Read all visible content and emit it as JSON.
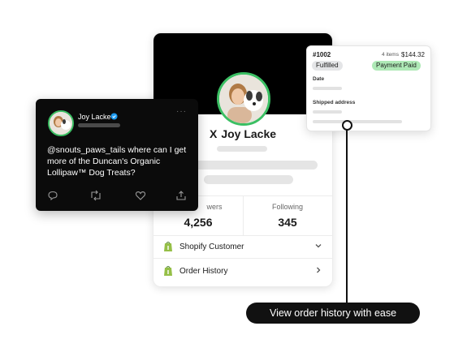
{
  "profile": {
    "name": "Joy Lacke",
    "followers_label": "wers",
    "followers_value": "4,256",
    "following_label": "Following",
    "following_value": "345",
    "menu": [
      {
        "label": "Shopify Customer",
        "icon": "shopify-icon",
        "chevron": "chevron-down-icon"
      },
      {
        "label": "Order History",
        "icon": "shopify-icon",
        "chevron": "chevron-right-icon"
      }
    ],
    "x_logo": "X"
  },
  "tweet": {
    "author": "Joy Lacke",
    "menu_glyph": "···",
    "text": "@snouts_paws_tails where can I get more of the Duncan's Organic Lollipaw™ Dog Treats?",
    "actions": [
      "reply-icon",
      "retweet-icon",
      "like-icon",
      "share-icon"
    ]
  },
  "order": {
    "number": "#1002",
    "items": "4 items",
    "total": "$144.32",
    "fulfillment_status": "Fulfilled",
    "payment_status": "Payment Paid",
    "date_label": "Date",
    "shipping_label": "Shipped address"
  },
  "callout": {
    "text": "View order history with ease"
  },
  "colors": {
    "accent_green": "#3bbf63",
    "shopify_green": "#95bf47",
    "paid_badge": "#aee9b6",
    "verified_blue": "#1d9bf0"
  }
}
